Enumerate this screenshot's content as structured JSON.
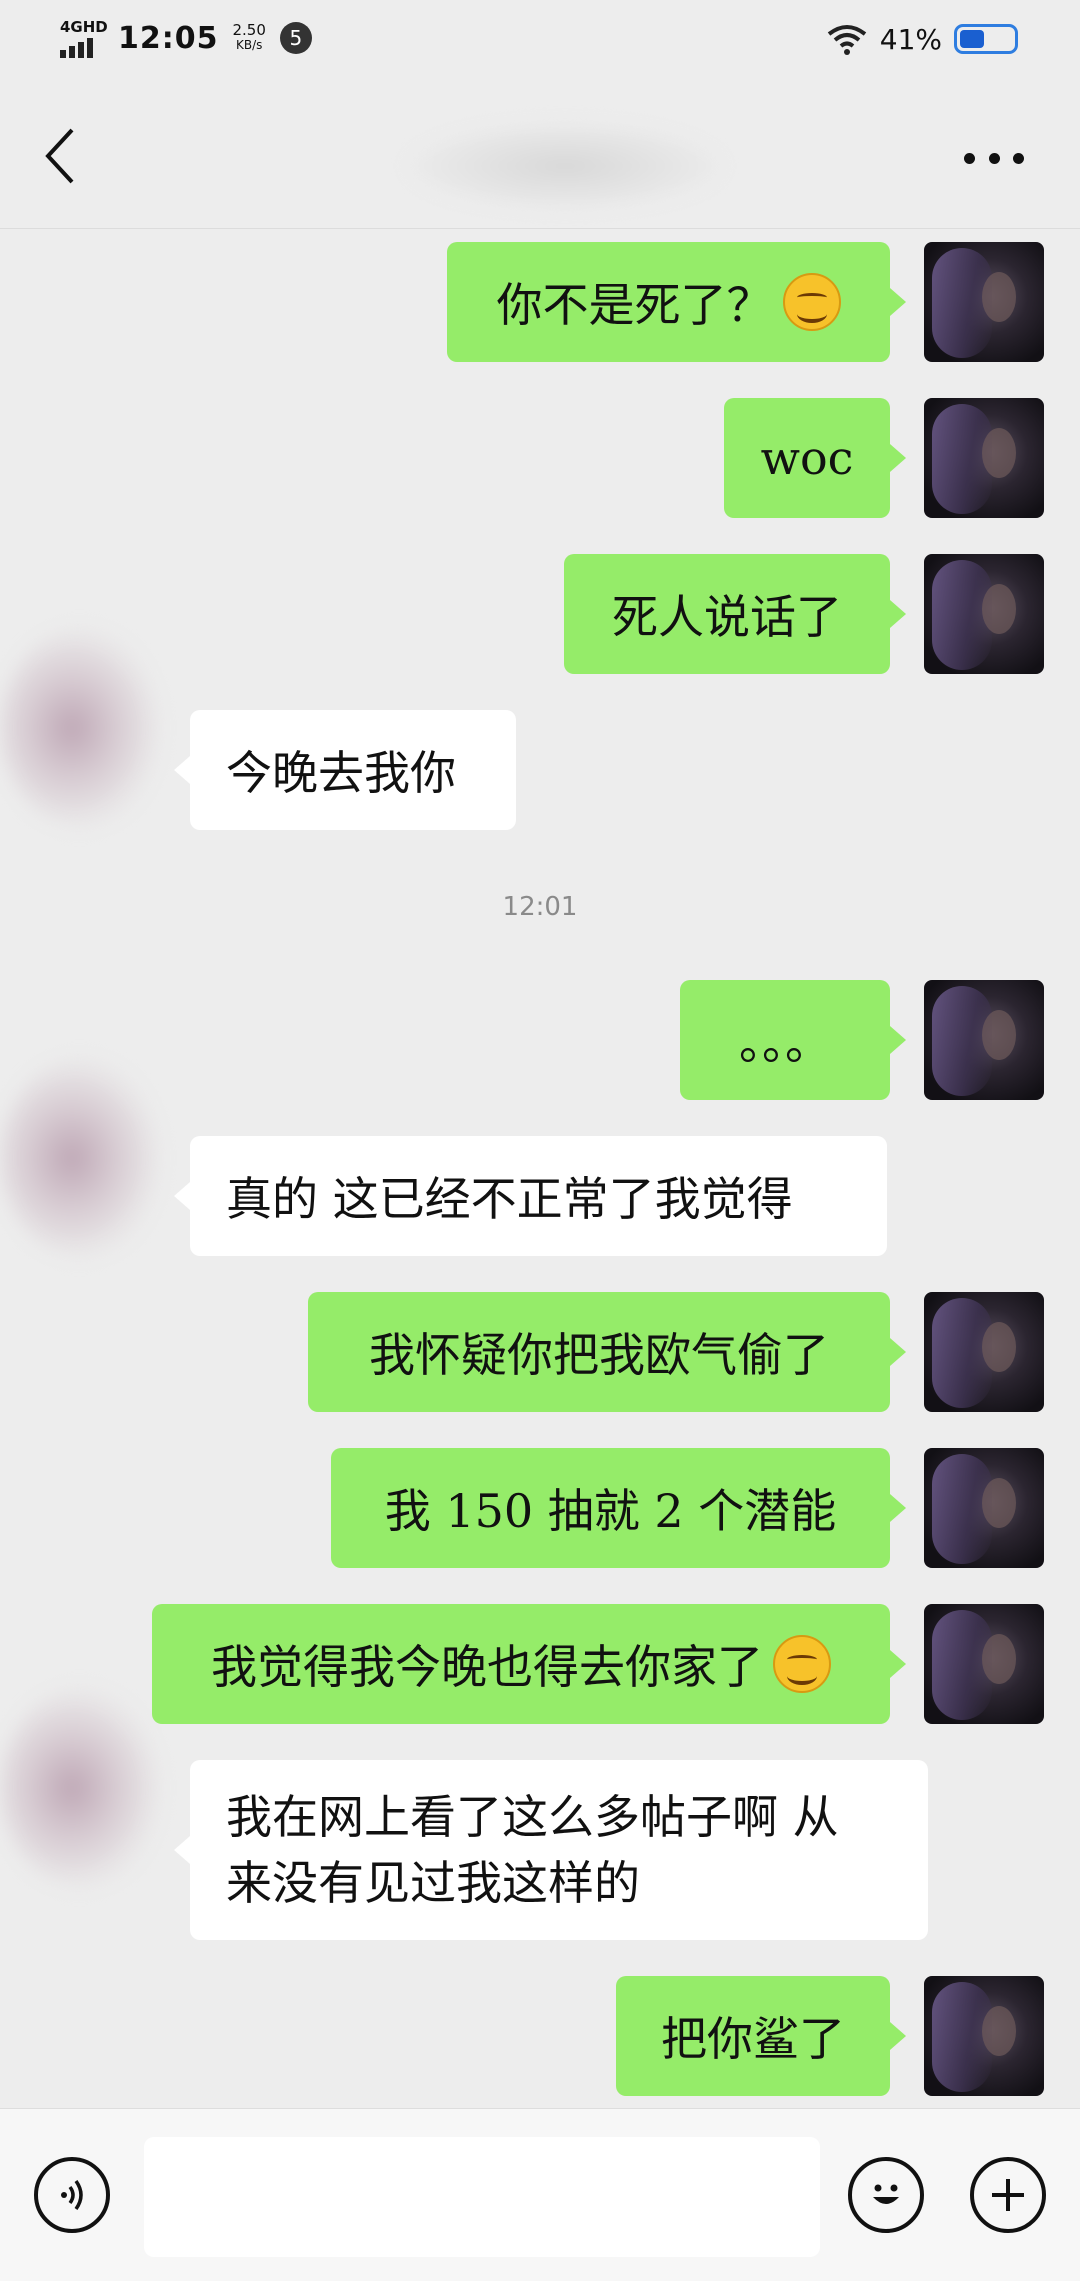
{
  "status_bar": {
    "network": "4GHD",
    "time": "12:05",
    "speed_value": "2.50",
    "speed_unit": "KB/s",
    "notification_count": "5",
    "battery_percent": "41%"
  },
  "navbar": {
    "title": "",
    "back_icon": "chevron-left-icon",
    "more_icon": "more-dots-icon"
  },
  "messages": [
    {
      "side": "me",
      "text": "你不是死了？",
      "emoji": "smirk-emoji"
    },
    {
      "side": "me",
      "text": "woc"
    },
    {
      "side": "me",
      "text": "死人说话了"
    },
    {
      "side": "other",
      "text": "今晚去我你"
    },
    {
      "type": "time",
      "text": "12:01"
    },
    {
      "side": "me",
      "text": "。。。"
    },
    {
      "side": "other",
      "text": "真的 这已经不正常了我觉得"
    },
    {
      "side": "me",
      "text": "我怀疑你把我欧气偷了"
    },
    {
      "side": "me",
      "text": "我 150 抽就 2 个潜能"
    },
    {
      "side": "me",
      "text": "我觉得我今晚也得去你家了",
      "emoji": "smirk-emoji"
    },
    {
      "side": "other",
      "line1": "我在网上看了这么多帖子啊 从",
      "line2": "来没有见过我这样的"
    },
    {
      "side": "me",
      "text": "把你鲨了"
    }
  ],
  "input_bar": {
    "voice_icon": "voice-icon",
    "emoji_icon": "emoji-face-icon",
    "plus_icon": "plus-icon",
    "placeholder": ""
  }
}
